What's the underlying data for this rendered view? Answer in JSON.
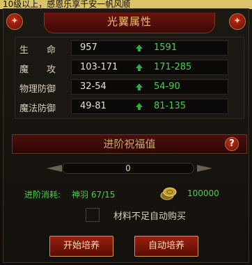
{
  "banner_text": "10级以上，感恩乐享千安一帆风顺",
  "panel": {
    "title": "光翼属性",
    "attributes": [
      {
        "label": "生　　命",
        "base": "957",
        "upgraded": "1591"
      },
      {
        "label": "魔　　攻",
        "base": "103-171",
        "upgraded": "171-285"
      },
      {
        "label": "物理防御",
        "base": "32-54",
        "upgraded": "54-90"
      },
      {
        "label": "魔法防御",
        "base": "49-81",
        "upgraded": "81-135"
      }
    ]
  },
  "advance": {
    "title": "进阶祝福值",
    "help_label": "?",
    "progress_value": "0",
    "progress_fraction": 0,
    "cost_label": "进阶消耗:",
    "cost_item": "神羽 67/15",
    "coin_amount": "100000",
    "auto_buy_label": "材料不足自动购买",
    "auto_buy_checked": false,
    "start_button": "开始培养",
    "auto_button": "自动培养"
  },
  "colors": {
    "accent_green": "#46d24a",
    "header_red": "#6b1410",
    "gold_text": "#ecc36a"
  }
}
